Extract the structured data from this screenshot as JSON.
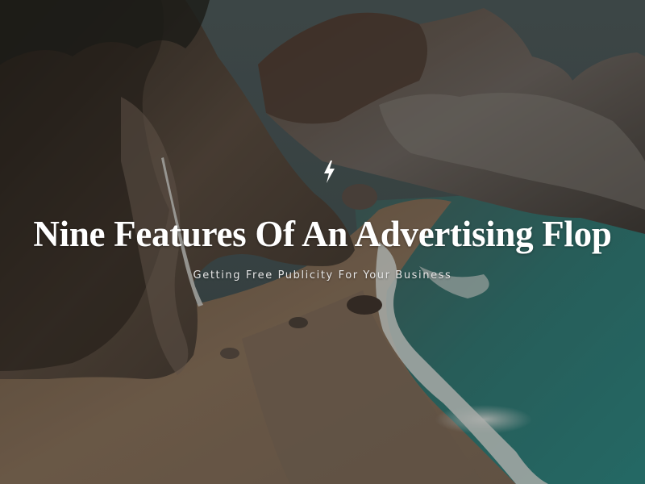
{
  "hero": {
    "title": "Nine Features Of An Advertising Flop",
    "subtitle": "Getting Free Publicity For Your Business",
    "icon": "bolt-icon",
    "background_image": "coastal-cove-with-waterfall"
  },
  "colors": {
    "title": "#ffffff",
    "subtitle": "#e6e6e6",
    "sea": "#2f7f7b",
    "sand": "#8a7660",
    "rock": "#4a3f36"
  }
}
